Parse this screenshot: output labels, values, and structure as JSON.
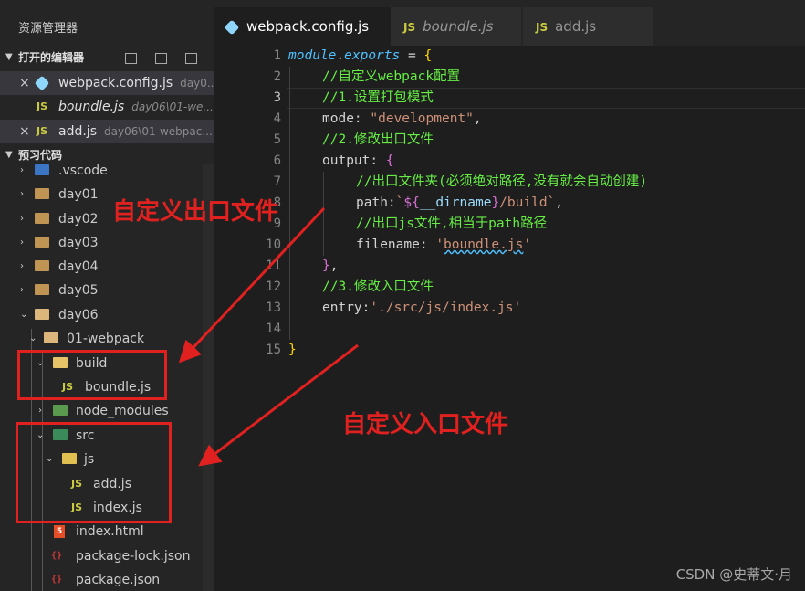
{
  "sidebar": {
    "title": "资源管理器",
    "open_editors": {
      "header": "打开的编辑器",
      "items": [
        {
          "close": "×",
          "icon": "webpack-icon",
          "name": "webpack.config.js",
          "path": "day0..."
        },
        {
          "close": "",
          "icon": "js-icon",
          "name": "boundle.js",
          "path": "day06\\01-we..."
        },
        {
          "close": "×",
          "icon": "js-icon",
          "name": "add.js",
          "path": "day06\\01-webpac..."
        }
      ]
    },
    "workspace": {
      "header": "预习代码",
      "items": [
        {
          "label": ".vscode"
        },
        {
          "label": "day01"
        },
        {
          "label": "day02"
        },
        {
          "label": "day03"
        },
        {
          "label": "day04"
        },
        {
          "label": "day05"
        },
        {
          "label": "day06"
        },
        {
          "label": "01-webpack"
        },
        {
          "label": "build"
        },
        {
          "label": "boundle.js"
        },
        {
          "label": "node_modules"
        },
        {
          "label": "src"
        },
        {
          "label": "js"
        },
        {
          "label": "add.js"
        },
        {
          "label": "index.js"
        },
        {
          "label": "index.html"
        },
        {
          "label": "package-lock.json"
        },
        {
          "label": "package.json"
        }
      ]
    }
  },
  "tabs": [
    {
      "label": "webpack.config.js",
      "icon": "webpack-icon",
      "active": true
    },
    {
      "label": "boundle.js",
      "icon": "js-icon",
      "active": false
    },
    {
      "label": "add.js",
      "icon": "js-icon",
      "active": false
    }
  ],
  "editor": {
    "current_line": 3,
    "lines": [
      {
        "n": "1"
      },
      {
        "n": "2"
      },
      {
        "n": "3"
      },
      {
        "n": "4"
      },
      {
        "n": "5"
      },
      {
        "n": "6"
      },
      {
        "n": "7"
      },
      {
        "n": "8"
      },
      {
        "n": "9"
      },
      {
        "n": "10"
      },
      {
        "n": "11"
      },
      {
        "n": "12"
      },
      {
        "n": "13"
      },
      {
        "n": "14"
      },
      {
        "n": "15"
      }
    ],
    "tokens": {
      "l1_module": "module",
      "l1_dot": ".",
      "l1_exports": "exports",
      "l1_eq": " = ",
      "l1_brace": "{",
      "l2": "//自定义webpack配置",
      "l3": "//1.设置打包模式",
      "l4_key": "mode: ",
      "l4_val": "\"development\"",
      "l4_comma": ",",
      "l5": "//2.修改出口文件",
      "l6_key": "output: ",
      "l6_brace": "{",
      "l7": "//出口文件夹(必须绝对路径,没有就会自动创建)",
      "l8_key": "path:",
      "l8_t1": "`",
      "l8_open": "${",
      "l8_var": "__dirname",
      "l8_close": "}",
      "l8_t2": "/build`",
      "l8_comma": ",",
      "l9": "//出口js文件,相当于path路径",
      "l10_key": "filename: ",
      "l10_q1": "'",
      "l10_val": "boundle.js",
      "l10_q2": "'",
      "l11_brace": "}",
      "l11_comma": ",",
      "l12": "//3.修改入口文件",
      "l13_key": "entry:",
      "l13_val": "'./src/js/index.js'",
      "l15_brace": "}"
    }
  },
  "annotations": {
    "output_label": "自定义出口文件",
    "entry_label": "自定义入口文件",
    "color": "#e0211f"
  },
  "watermark": "CSDN @史蒂文·月"
}
